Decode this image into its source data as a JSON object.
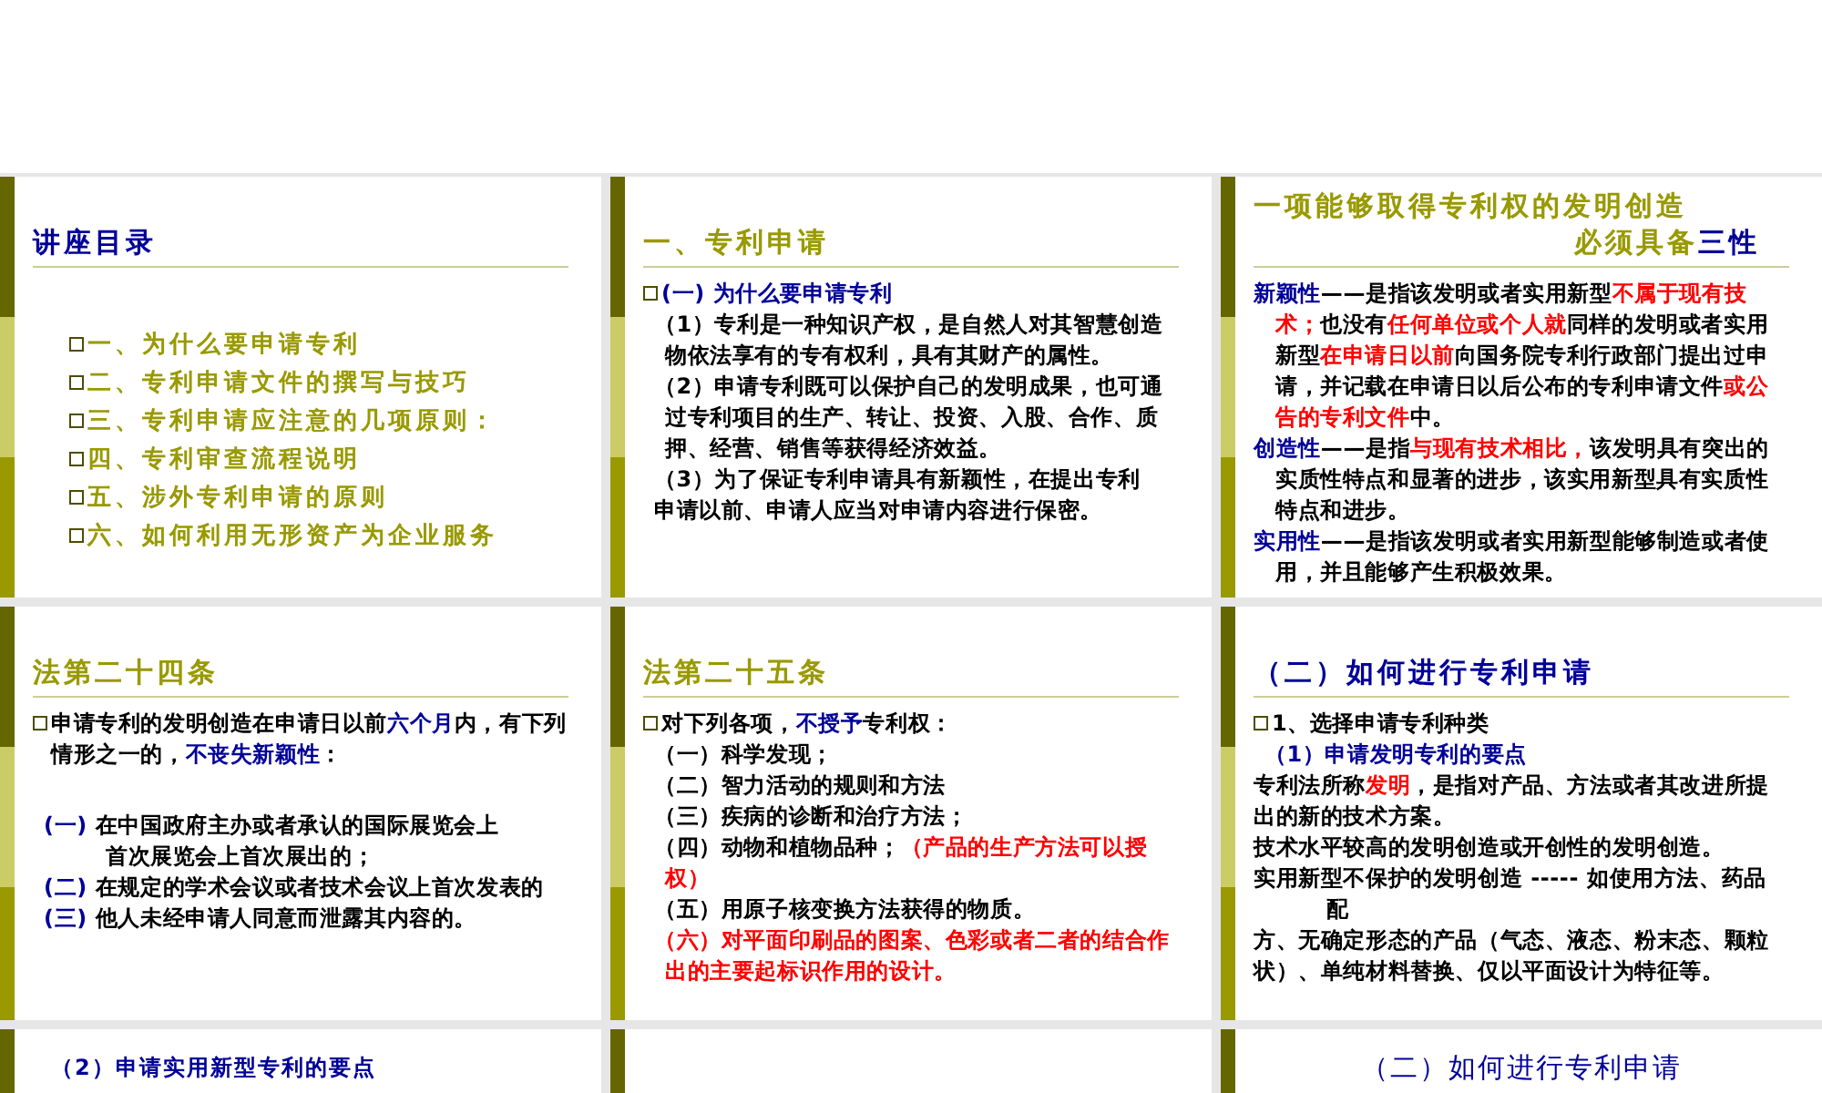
{
  "slides": [
    {
      "kind": "slide",
      "title_lines": [
        {
          "runs": [
            {
              "text": "讲座目录",
              "color": "#000099"
            }
          ]
        }
      ],
      "blocks": [
        [
          {
            "kind": "toc",
            "runs": [
              {
                "text": "一、为什么要申请专利",
                "color": "#999900"
              }
            ]
          },
          {
            "kind": "toc",
            "runs": [
              {
                "text": "二、专利申请文件的撰写与技巧",
                "color": "#999900"
              }
            ]
          },
          {
            "kind": "toc",
            "runs": [
              {
                "text": "三、专利申请应注意的几项原则：",
                "color": "#999900"
              }
            ]
          },
          {
            "kind": "toc",
            "runs": [
              {
                "text": "四、专利审查流程说明",
                "color": "#999900"
              }
            ]
          },
          {
            "kind": "toc",
            "runs": [
              {
                "text": "五、涉外专利申请的原则",
                "color": "#999900"
              }
            ]
          },
          {
            "kind": "toc",
            "runs": [
              {
                "text": "六、如何利用无形资产为企业服务",
                "color": "#999900"
              }
            ]
          }
        ]
      ]
    },
    {
      "kind": "slide",
      "title_lines": [
        {
          "runs": [
            {
              "text": "一、专利申请",
              "color": "#999900"
            }
          ]
        }
      ],
      "blocks": [
        [
          {
            "kind": "bullet",
            "runs": [
              {
                "text": "(一) 为什么要申请专利",
                "color": "#000099"
              }
            ]
          },
          {
            "kind": "line",
            "runs": [
              {
                "text": "（1）专利是一种知识产权，是自然人对其智慧创造物依法享有的专有权利，具有其财产的属性。",
                "color": "#000000"
              }
            ]
          },
          {
            "kind": "line",
            "runs": [
              {
                "text": "（2）申请专利既可以保护自己的发明成果，也可通过专利项目的生产、转让、投资、入股、合作、质押、经营、销售等获得经济效益。",
                "color": "#000000"
              }
            ]
          },
          {
            "kind": "line",
            "runs": [
              {
                "text": "（3）为了保证专利申请具有新颖性，在提出专利",
                "color": "#000000"
              }
            ]
          },
          {
            "kind": "line",
            "runs": [
              {
                "text": "申请以前、申请人应当对申请内容进行保密。",
                "color": "#000000"
              }
            ]
          }
        ]
      ]
    },
    {
      "kind": "slide",
      "title_lines": [
        {
          "runs": [
            {
              "text": "一项能够取得专利权的发明创造",
              "color": "#999900"
            }
          ]
        },
        {
          "runs": [
            {
              "text": "必须具备",
              "color": "#999900"
            },
            {
              "text": "三性",
              "color": "#000099"
            }
          ]
        }
      ],
      "blocks": [
        [
          {
            "kind": "term",
            "runs": [
              {
                "text": "新颖性",
                "color": "#000099"
              },
              {
                "text": "——是指该发明或者实用新型",
                "color": "#000000"
              },
              {
                "text": "不属于现有技术；",
                "color": "#ff0000"
              },
              {
                "text": "也没有",
                "color": "#000000"
              },
              {
                "text": "任何单位或个人就",
                "color": "#ff0000"
              },
              {
                "text": "同样的发明或者实用新型",
                "color": "#000000"
              },
              {
                "text": "在申请日以前",
                "color": "#ff0000"
              },
              {
                "text": "向国务院专利行政部门提出过申请，并记载在申请日以后公布的专利申请文件",
                "color": "#000000"
              },
              {
                "text": "或公告的专利文件",
                "color": "#ff0000"
              },
              {
                "text": "中。",
                "color": "#000000"
              }
            ]
          },
          {
            "kind": "term",
            "runs": [
              {
                "text": "创造性",
                "color": "#000099"
              },
              {
                "text": "——是指",
                "color": "#000000"
              },
              {
                "text": "与现有技术相比，",
                "color": "#ff0000"
              },
              {
                "text": "该发明具有突出的实质性特点和显著的进步，该实用新型具有实质性特点和进步。",
                "color": "#000000"
              }
            ]
          },
          {
            "kind": "term",
            "runs": [
              {
                "text": "实用性",
                "color": "#000099"
              },
              {
                "text": "——是指该发明或者实用新型能够制造或者使用，并且能够产生积极效果。",
                "color": "#000000"
              }
            ]
          }
        ]
      ]
    },
    {
      "kind": "slide",
      "title_lines": [
        {
          "runs": [
            {
              "text": "法第二十四条",
              "color": "#999900"
            }
          ]
        }
      ],
      "blocks": [
        [
          {
            "kind": "bullet",
            "runs": [
              {
                "text": "申请专利的发明创造在申请日以前",
                "color": "#000000"
              },
              {
                "text": "六个月",
                "color": "#000099"
              },
              {
                "text": "内，有下列情形之一的，",
                "color": "#000000"
              },
              {
                "text": "不丧失新颖性",
                "color": "#000099"
              },
              {
                "text": "：",
                "color": "#000000"
              }
            ]
          }
        ],
        [
          {
            "kind": "line",
            "runs": [
              {
                "text": "(一) ",
                "color": "#000099"
              },
              {
                "text": "在中国政府主办或者承认的国际展览会上",
                "color": "#000000"
              }
            ]
          },
          {
            "kind": "indented",
            "runs": [
              {
                "text": "首次展览会上首次展出的；",
                "color": "#000000"
              }
            ]
          },
          {
            "kind": "line",
            "runs": [
              {
                "text": "(二) ",
                "color": "#000099"
              },
              {
                "text": "在规定的学术会议或者技术会议上首次发表的",
                "color": "#000000"
              }
            ]
          },
          {
            "kind": "line",
            "runs": [
              {
                "text": "(三) ",
                "color": "#000099"
              },
              {
                "text": "他人未经申请人同意而泄露其内容的。",
                "color": "#000000"
              }
            ]
          }
        ]
      ]
    },
    {
      "kind": "slide",
      "title_lines": [
        {
          "runs": [
            {
              "text": "法第二十五条",
              "color": "#999900"
            }
          ]
        }
      ],
      "blocks": [
        [
          {
            "kind": "bullet",
            "runs": [
              {
                "text": "对下列各项，",
                "color": "#000000"
              },
              {
                "text": "不授予",
                "color": "#000099"
              },
              {
                "text": "专利权：",
                "color": "#000000"
              }
            ]
          },
          {
            "kind": "line",
            "runs": [
              {
                "text": "（一）科学发现；",
                "color": "#000000"
              }
            ]
          },
          {
            "kind": "line",
            "runs": [
              {
                "text": "（二）智力活动的规则和方法",
                "color": "#000000"
              }
            ]
          },
          {
            "kind": "line",
            "runs": [
              {
                "text": "（三）疾病的诊断和治疗方法；",
                "color": "#000000"
              }
            ]
          },
          {
            "kind": "line",
            "runs": [
              {
                "text": "（四）动物和植物品种；",
                "color": "#000000"
              },
              {
                "text": "（产品的生产方法可以授权）",
                "color": "#ff0000"
              }
            ]
          },
          {
            "kind": "line",
            "runs": [
              {
                "text": "（五）用原子核变换方法获得的物质。",
                "color": "#000000"
              }
            ]
          },
          {
            "kind": "line",
            "runs": [
              {
                "text": "（六）对平面印刷品的图案、色彩或者二者的结合作出的主要起标识作用的设计。",
                "color": "#ff0000"
              }
            ]
          }
        ]
      ]
    },
    {
      "kind": "slide",
      "title_lines": [
        {
          "runs": [
            {
              "text": "（二）如何进行专利申请",
              "color": "#000099"
            }
          ]
        }
      ],
      "blocks": [
        [
          {
            "kind": "bullet",
            "runs": [
              {
                "text": "1、选择申请专利种类",
                "color": "#000000"
              }
            ]
          },
          {
            "kind": "line",
            "runs": [
              {
                "text": "（1）申请发明专利的要点",
                "color": "#000099"
              }
            ]
          },
          {
            "kind": "plain",
            "runs": [
              {
                "text": "专利法所称",
                "color": "#000000"
              },
              {
                "text": "发明",
                "color": "#ff0000"
              },
              {
                "text": "，是指对产品、方法或者其改进所提出的新的技术方案。",
                "color": "#000000"
              }
            ]
          },
          {
            "kind": "plain",
            "runs": [
              {
                "text": "技术水平较高的发明创造或开创性的发明创造。",
                "color": "#000000"
              }
            ]
          },
          {
            "kind": "plain",
            "runs": [
              {
                "text": "实用新型不保护的发明创造 ----- 如使用方法、药品",
                "color": "#000000"
              }
            ]
          },
          {
            "kind": "indented",
            "runs": [
              {
                "text": "配",
                "color": "#000000"
              }
            ]
          },
          {
            "kind": "plain",
            "runs": [
              {
                "text": "方、无确定形态的产品（气态、液态、粉末态、颗粒状）、单纯材料替换、仅以平面设计为特征等。",
                "color": "#000000"
              }
            ]
          }
        ]
      ]
    },
    {
      "kind": "slide",
      "title_lines": [
        {
          "runs": [
            {
              "text": "（2）申请实用新型专利的要点",
              "color": "#000099"
            }
          ]
        }
      ]
    },
    {
      "kind": "slide"
    },
    {
      "kind": "slide",
      "title_lines": [
        {
          "runs": [
            {
              "text": "（二）如何进行专利申请",
              "color": "#000099"
            }
          ]
        }
      ]
    }
  ]
}
